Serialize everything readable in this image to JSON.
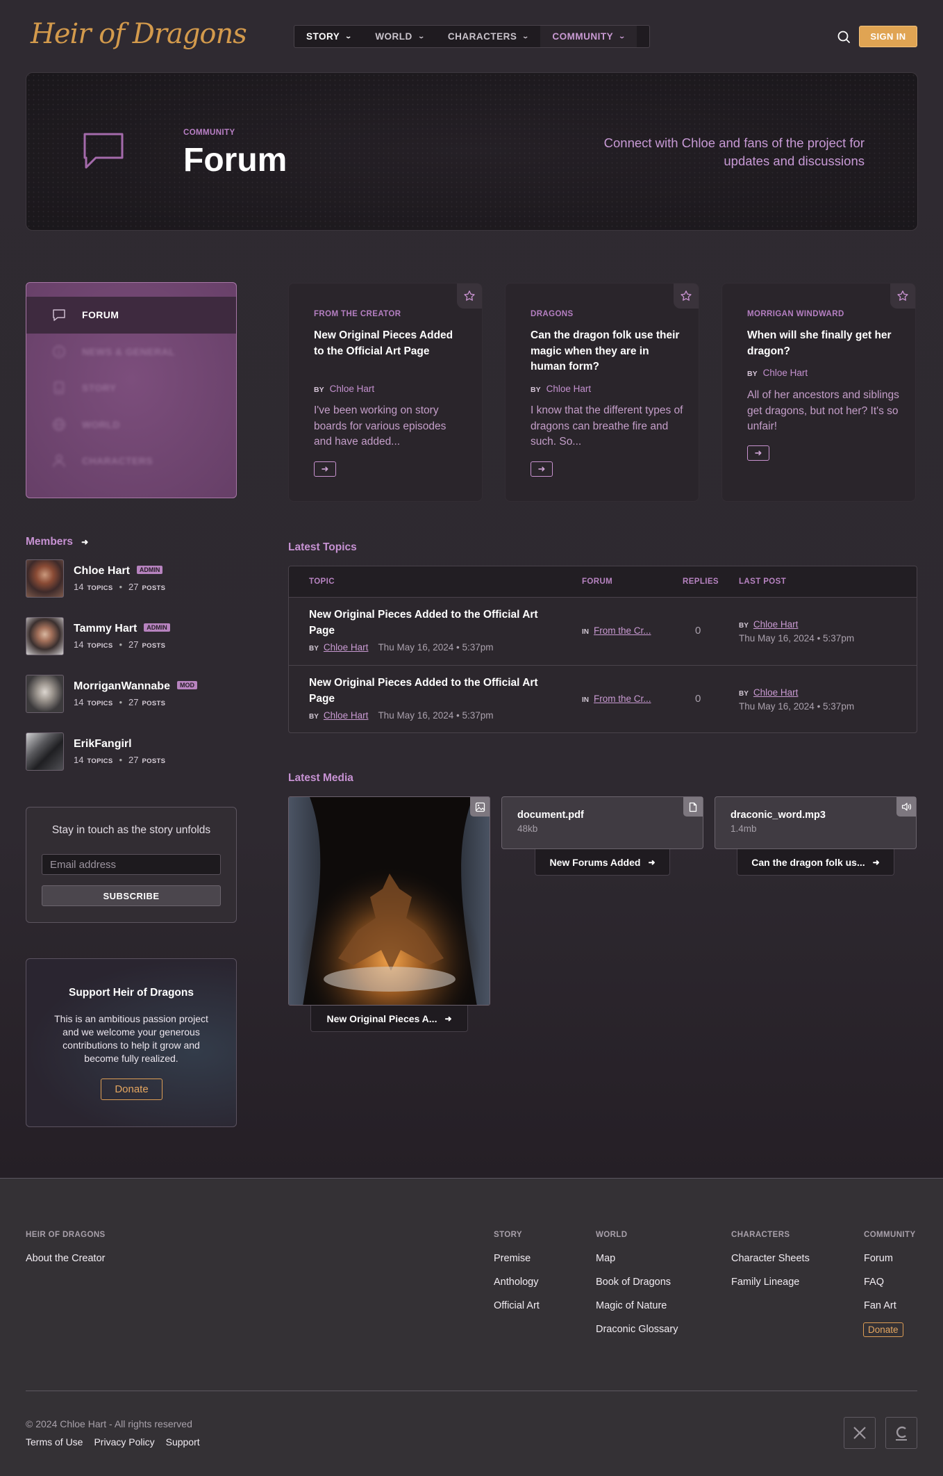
{
  "header": {
    "logo_text": "Heir of Dragons",
    "nav": [
      {
        "label": "STORY"
      },
      {
        "label": "WORLD"
      },
      {
        "label": "CHARACTERS"
      },
      {
        "label": "COMMUNITY",
        "active": true
      }
    ],
    "signin_label": "SIGN IN",
    "icons": {
      "search": "search-icon",
      "chevron": "chevron-down-icon"
    },
    "accent": "#e0a453"
  },
  "hero": {
    "eyebrow": "COMMUNITY",
    "title": "Forum",
    "description": "Connect with Chloe and fans of the project for updates and discussions",
    "icon": "chat-bubble-icon"
  },
  "sidebar": {
    "items": [
      {
        "label": "FORUM",
        "icon": "chat-bubble-icon",
        "active": true
      },
      {
        "label": "NEWS & GENERAL",
        "icon": "info-icon"
      },
      {
        "label": "STORY",
        "icon": "book-icon"
      },
      {
        "label": "WORLD",
        "icon": "globe-icon"
      },
      {
        "label": "CHARACTERS",
        "icon": "person-icon"
      }
    ]
  },
  "featured": [
    {
      "category": "FROM THE CREATOR",
      "title": "New Original Pieces Added to the Official Art Page",
      "by_label": "BY",
      "author": "Chloe Hart",
      "excerpt": "I've been working on story boards for various episodes and have added..."
    },
    {
      "category": "DRAGONS",
      "title": "Can the dragon folk use their magic when they are in human form?",
      "by_label": "BY",
      "author": "Chloe Hart",
      "excerpt": "I know that the different types of dragons can breathe fire and such. So..."
    },
    {
      "category": "MORRIGAN WINDWARD",
      "title": "When will she finally get her dragon?",
      "by_label": "BY",
      "author": "Chloe Hart",
      "excerpt": "All of her ancestors and siblings get dragons, but not her? It's so unfair!"
    }
  ],
  "members": {
    "heading": "Members",
    "topics_label": "TOPICS",
    "posts_label": "POSTS",
    "list": [
      {
        "name": "Chloe Hart",
        "badge": "ADMIN",
        "topics": "14",
        "posts": "27"
      },
      {
        "name": "Tammy Hart",
        "badge": "ADMIN",
        "topics": "14",
        "posts": "27"
      },
      {
        "name": "MorriganWannabe",
        "badge": "MOD",
        "topics": "14",
        "posts": "27"
      },
      {
        "name": "ErikFangirl",
        "badge": "",
        "topics": "14",
        "posts": "27"
      }
    ]
  },
  "newsletter": {
    "heading": "Stay in touch as the story unfolds",
    "placeholder": "Email address",
    "button": "SUBSCRIBE"
  },
  "support": {
    "heading": "Support Heir of Dragons",
    "body": "This is an ambitious passion project and we welcome your generous contributions to help it grow and become fully realized.",
    "button": "Donate"
  },
  "latest_topics": {
    "heading": "Latest Topics",
    "columns": [
      "TOPIC",
      "FORUM",
      "REPLIES",
      "LAST POST"
    ],
    "in_label": "IN",
    "by_label": "BY",
    "rows": [
      {
        "title": "New Original Pieces Added to the Official Art Page",
        "author": "Chloe Hart",
        "date": "Thu May 16, 2024 • 5:37pm",
        "forum": "From the Cr...",
        "replies": "0",
        "last_author": "Chloe Hart",
        "last_date": "Thu May 16, 2024 • 5:37pm"
      },
      {
        "title": "New Original Pieces Added to the Official Art Page",
        "author": "Chloe Hart",
        "date": "Thu May 16, 2024 • 5:37pm",
        "forum": "From the Cr...",
        "replies": "0",
        "last_author": "Chloe Hart",
        "last_date": "Thu May 16, 2024 • 5:37pm"
      }
    ]
  },
  "latest_media": {
    "heading": "Latest Media",
    "items": [
      {
        "type": "image",
        "icon": "image-icon",
        "caption": "New Original Pieces A..."
      },
      {
        "type": "file",
        "icon": "file-icon",
        "name": "document.pdf",
        "size": "48kb",
        "caption": "New Forums Added"
      },
      {
        "type": "audio",
        "icon": "speaker-icon",
        "name": "draconic_word.mp3",
        "size": "1.4mb",
        "caption": "Can the dragon folk us..."
      }
    ]
  },
  "footer": {
    "columns": [
      {
        "heading": "HEIR OF DRAGONS",
        "links": [
          "About the Creator"
        ]
      },
      {
        "heading": "STORY",
        "links": [
          "Premise",
          "Anthology",
          "Official Art"
        ]
      },
      {
        "heading": "WORLD",
        "links": [
          "Map",
          "Book of Dragons",
          "Magic of Nature",
          "Draconic Glossary"
        ]
      },
      {
        "heading": "CHARACTERS",
        "links": [
          "Character Sheets",
          "Family Lineage"
        ]
      },
      {
        "heading": "COMMUNITY",
        "links": [
          "Forum",
          "FAQ",
          "Fan Art"
        ],
        "donate": "Donate"
      }
    ],
    "copyright": "© 2024 Chloe Hart - All rights reserved",
    "legal": [
      "Terms of Use",
      "Privacy Policy",
      "Support"
    ],
    "social": [
      "x-icon",
      "c-icon"
    ]
  }
}
